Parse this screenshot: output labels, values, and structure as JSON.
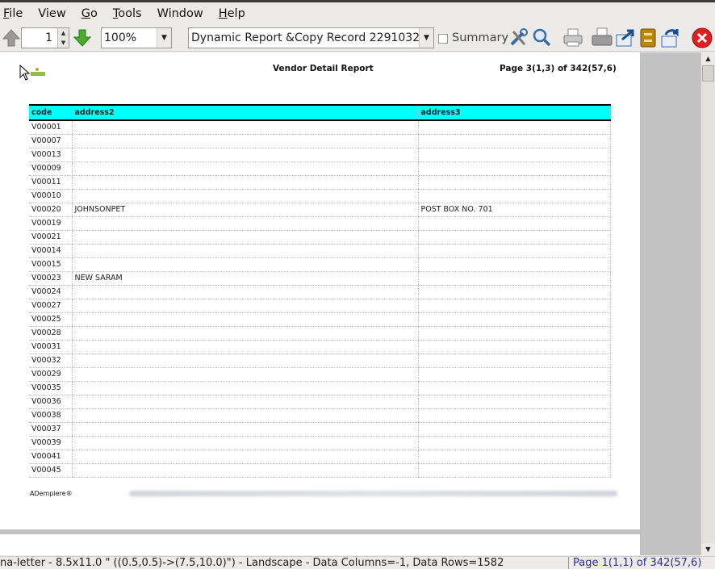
{
  "menu": [
    {
      "label": "File"
    },
    {
      "label": "View"
    },
    {
      "label": "Go"
    },
    {
      "label": "Tools"
    },
    {
      "label": "Window"
    },
    {
      "label": "Help"
    }
  ],
  "toolbar": {
    "page_number": "1",
    "zoom": "100%",
    "report_selector": "Dynamic Report &Copy Record 2291032",
    "summary_label": "Summary"
  },
  "report": {
    "title": "Vendor Detail Report",
    "page_info": "Page 3(1,3) of 342(57,6)",
    "columns": [
      "code",
      "address2",
      "address3"
    ],
    "rows": [
      [
        "V00001",
        "",
        ""
      ],
      [
        "V00007",
        "",
        ""
      ],
      [
        "V00013",
        "",
        ""
      ],
      [
        "V00009",
        "",
        ""
      ],
      [
        "V00011",
        "",
        ""
      ],
      [
        "V00010",
        "",
        ""
      ],
      [
        "V00020",
        "JOHNSONPET",
        "POST BOX NO. 701"
      ],
      [
        "V00019",
        "",
        ""
      ],
      [
        "V00021",
        "",
        ""
      ],
      [
        "V00014",
        "",
        ""
      ],
      [
        "V00015",
        "",
        ""
      ],
      [
        "V00023",
        "NEW SARAM",
        ""
      ],
      [
        "V00024",
        "",
        ""
      ],
      [
        "V00027",
        "",
        ""
      ],
      [
        "V00025",
        "",
        ""
      ],
      [
        "V00028",
        "",
        ""
      ],
      [
        "V00031",
        "",
        ""
      ],
      [
        "V00032",
        "",
        ""
      ],
      [
        "V00029",
        "",
        ""
      ],
      [
        "V00035",
        "",
        ""
      ],
      [
        "V00036",
        "",
        ""
      ],
      [
        "V00038",
        "",
        ""
      ],
      [
        "V00037",
        "",
        ""
      ],
      [
        "V00039",
        "",
        ""
      ],
      [
        "V00041",
        "",
        ""
      ],
      [
        "V00045",
        "",
        ""
      ]
    ],
    "footer_brand": "ADempiere®"
  },
  "status": {
    "left": "na-letter - 8.5x11.0 \" ((0.5,0.5)->(7.5,10.0)\") - Landscape - Data Columns=-1, Data Rows=1582",
    "right": "Page 1(1,1) of 342(57,6)"
  },
  "colors": {
    "header_fill": "#00ffff",
    "close_red": "#e02020"
  }
}
